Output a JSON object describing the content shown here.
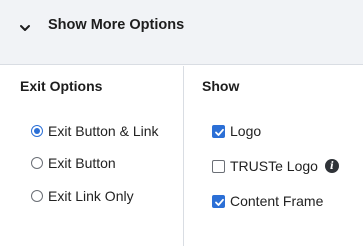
{
  "header": {
    "label": "Show More Options",
    "icon": "chevron-down-icon"
  },
  "exit_options": {
    "title": "Exit Options",
    "options": [
      {
        "label": "Exit Button & Link",
        "selected": true
      },
      {
        "label": "Exit Button",
        "selected": false
      },
      {
        "label": "Exit Link Only",
        "selected": false
      }
    ]
  },
  "show": {
    "title": "Show",
    "options": [
      {
        "label": "Logo",
        "checked": true
      },
      {
        "label": "TRUSTe Logo",
        "checked": false,
        "info_icon": "info-icon",
        "info_glyph": "i"
      },
      {
        "label": "Content Frame",
        "checked": true
      }
    ]
  },
  "colors": {
    "accent": "#2b6fd6",
    "header_bg": "#f1f3f6",
    "border": "#d9dde3"
  }
}
